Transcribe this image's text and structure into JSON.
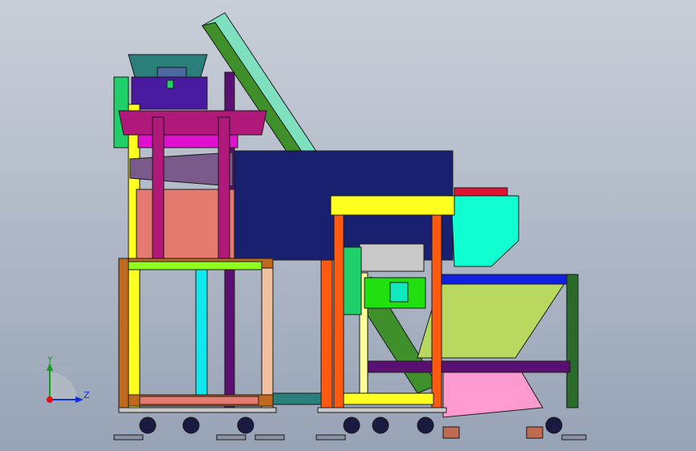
{
  "triad": {
    "x_label": "",
    "y_label": "Y",
    "z_label": "Z"
  },
  "colors": {
    "background_top": "#c9cfd8",
    "background_bottom": "#97a3b6",
    "outline": "#1a1a1a",
    "conveyor_belt": "#7fe0c0",
    "conveyor_side": "#3f8f2a",
    "hopper_top": "#2a7f7a",
    "hopper_body": "#4a1aa0",
    "feeder_plate": "#b0187a",
    "frame_side_green": "#1fd06a",
    "frame_magenta": "#e010d0",
    "salmon_box": "#e47a70",
    "navy_box": "#1a2070",
    "yellow_frame": "#ffff20",
    "orange_post": "#ff5a10",
    "teal_chute": "#10ffd0",
    "motor_green": "#20e010",
    "olive_bin": "#b8d860",
    "blue_rail": "#1020e0",
    "pink_stand": "#ff9ad0",
    "dark_green_post": "#2a6a2a",
    "tan_leg": "#f0c0a0",
    "cyan_bar": "#10e8f0",
    "purple_bar": "#5a1070",
    "brown_frame": "#c06a20",
    "lime_bar": "#90ff20"
  }
}
